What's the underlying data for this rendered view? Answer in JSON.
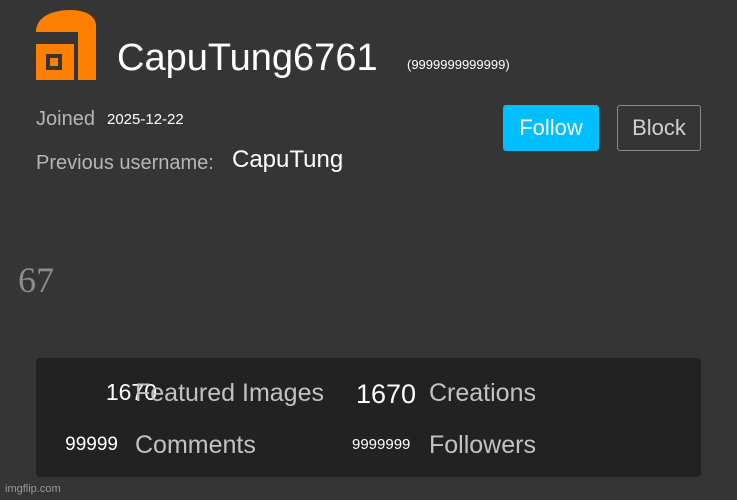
{
  "profile": {
    "username": "CapuTung6761",
    "user_id": "(9999999999999)",
    "joined_label": "Joined",
    "joined_date": "2025-12-22",
    "previous_username_label": "Previous username:",
    "previous_username": "CapuTung",
    "big_number": "67"
  },
  "actions": {
    "follow_label": "Follow",
    "block_label": "Block"
  },
  "stats": {
    "featured_images": {
      "value": "1670",
      "label": "Featured Images"
    },
    "creations": {
      "value": "1670",
      "label": "Creations"
    },
    "comments": {
      "value": "99999",
      "label": "Comments"
    },
    "followers": {
      "value": "9999999",
      "label": "Followers"
    }
  },
  "watermark": "imgflip.com",
  "colors": {
    "background": "#353535",
    "panel": "#222222",
    "accent_follow": "#00bfff",
    "logo_orange": "#ff8000"
  },
  "icons": {
    "logo": "imgflip-logo"
  }
}
